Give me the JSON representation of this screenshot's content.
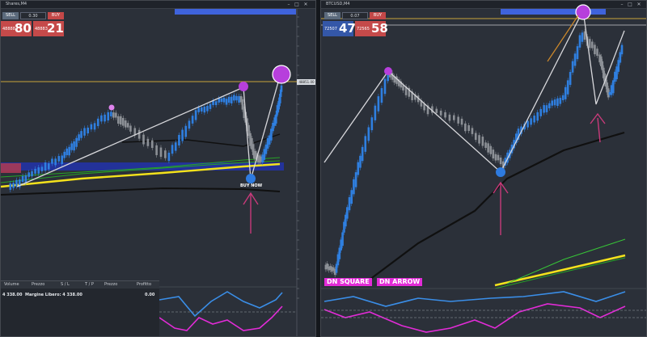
{
  "colors": {
    "bg": "#2b3039",
    "bull": "#2f7fe0",
    "bear": "#8c9096",
    "gold": "#c9a43a",
    "purple": "#b73fdc",
    "pink": "#e22bd7",
    "yellow": "#f4e21c",
    "green": "#3fc53f",
    "blue_bar": "#4466e0",
    "arrow": "#c83a7a"
  },
  "left_window": {
    "title": "Shares,M4",
    "trade": {
      "sell": "SELL",
      "volume": "0.30",
      "buy": "BUY",
      "bid_small": "48888",
      "bid_big": "80",
      "ask_small": "48883",
      "ask_big": "21"
    },
    "buy_now": "BUY NOW",
    "price_tag": "48851.00"
  },
  "right_window": {
    "title": "BTCUSD,M4",
    "trade": {
      "sell": "SELL",
      "volume": "0.07",
      "buy": "BUY",
      "bid_small": "72507",
      "bid_big": "47",
      "ask_small": "72565",
      "ask_big": "58"
    },
    "labels": {
      "dn_square": "DN SQUARE",
      "dn_arrow": "DN ARROW"
    }
  },
  "icons": {
    "close": "close-icon",
    "minimize": "minimize-icon",
    "maximize": "maximize-icon",
    "chart": "chart-icon"
  },
  "positions_panel": {
    "headers": {
      "volume": "Volume",
      "price": "Prezzo",
      "sl": "S / L",
      "tp": "T / P",
      "price2": "Prezzo",
      "profit": "Profitto"
    },
    "balance": "4 338.00",
    "free_margin": "Margine Libero: 4 338.00",
    "profit": "0.00"
  }
}
